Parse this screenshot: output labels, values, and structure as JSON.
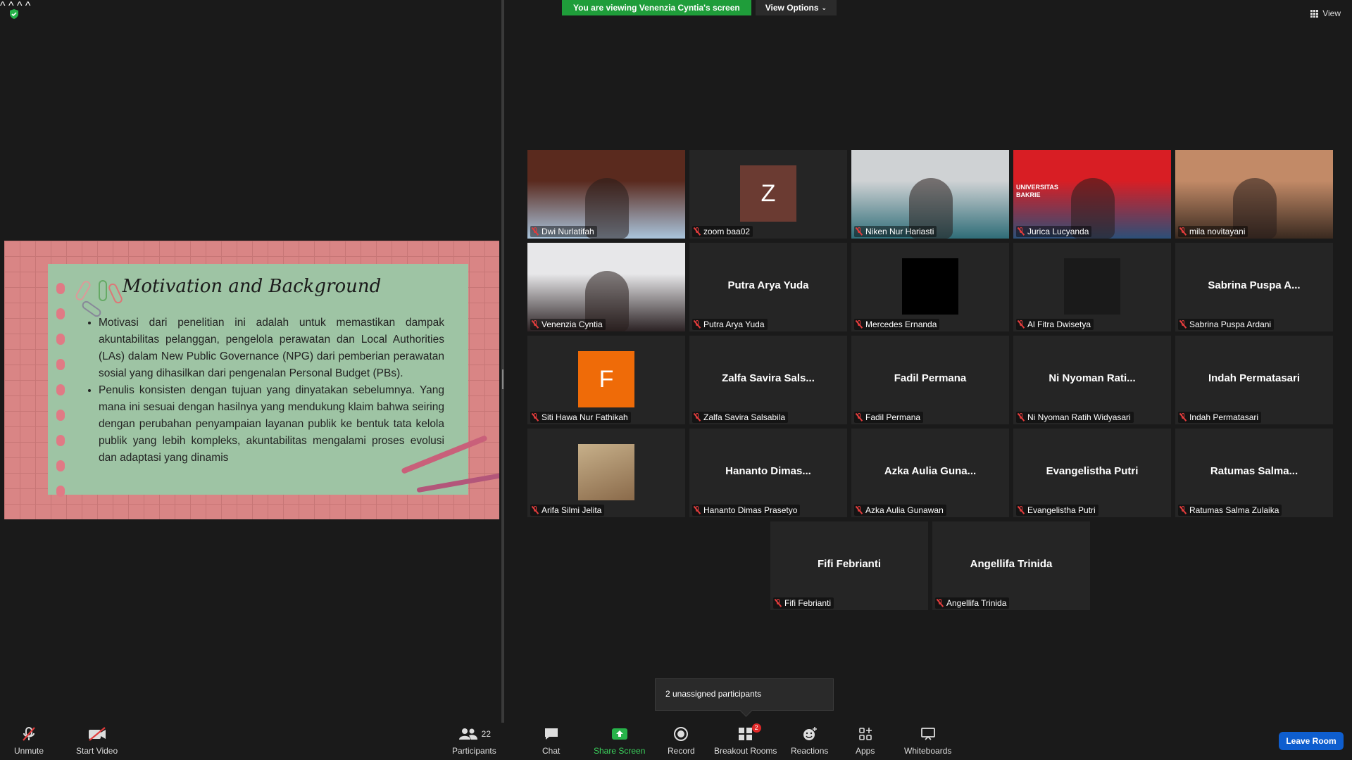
{
  "banner": {
    "viewing": "You are viewing Venenzia Cyntia's screen",
    "view_options": "View Options"
  },
  "view_label": "View",
  "slide": {
    "title": "Motivation and Background",
    "bullets": [
      "Motivasi dari penelitian ini adalah untuk memastikan dampak akuntabilitas pelanggan, pengelola perawatan dan Local Authorities (LAs) dalam New Public Governance (NPG) dari pemberian perawatan sosial yang dihasilkan dari pengenalan Personal Budget (PBs).",
      "Penulis konsisten dengan tujuan yang dinyatakan sebelumnya. Yang mana ini sesuai dengan hasilnya yang mendukung klaim bahwa seiring dengan perubahan penyampaian layanan publik ke bentuk tata kelola publik yang lebih kompleks, akuntabilitas mengalami proses evolusi dan adaptasi yang dinamis"
    ]
  },
  "participants": [
    {
      "label": "Dwi Nurlatifah",
      "center": "",
      "avatar": "",
      "type": "video",
      "colors": [
        "#5a2a1e",
        "#a9c4dc"
      ]
    },
    {
      "label": "zoom baa02",
      "center": "",
      "avatar": "Z",
      "type": "avatar",
      "colors": [
        "#6b3b32"
      ]
    },
    {
      "label": "Niken Nur Hariasti",
      "center": "",
      "avatar": "",
      "type": "video",
      "colors": [
        "#cfd2d4",
        "#2f6d78"
      ]
    },
    {
      "label": "Jurica Lucyanda",
      "center": "",
      "avatar": "",
      "type": "video",
      "colors": [
        "#d81e24",
        "#2c4f78"
      ],
      "overlay": "UNIVERSITAS BAKRIE"
    },
    {
      "label": "mila novitayani",
      "center": "",
      "avatar": "",
      "type": "video",
      "colors": [
        "#c28a67",
        "#3a2a20"
      ],
      "active": true
    },
    {
      "label": "Venenzia Cyntia",
      "center": "",
      "avatar": "",
      "type": "video",
      "colors": [
        "#e7e7e9",
        "#2b2224"
      ]
    },
    {
      "label": "Putra Arya Yuda",
      "center": "Putra Arya Yuda",
      "avatar": "",
      "type": "name"
    },
    {
      "label": "Mercedes Ernanda",
      "center": "",
      "avatar": "",
      "type": "black"
    },
    {
      "label": "Al Fitra Dwisetya",
      "center": "",
      "avatar": "",
      "type": "dark"
    },
    {
      "label": "Sabrina Puspa Ardani",
      "center": "Sabrina Puspa A...",
      "avatar": "",
      "type": "name"
    },
    {
      "label": "Siti Hawa Nur Fathikah",
      "center": "",
      "avatar": "F",
      "type": "avatar",
      "colors": [
        "#ef6b08"
      ]
    },
    {
      "label": "Zalfa Savira Salsabila",
      "center": "Zalfa Savira Sals...",
      "avatar": "",
      "type": "name"
    },
    {
      "label": "Fadil Permana",
      "center": "Fadil Permana",
      "avatar": "",
      "type": "name"
    },
    {
      "label": "Ni Nyoman Ratih Widyasari",
      "center": "Ni Nyoman Rati...",
      "avatar": "",
      "type": "name"
    },
    {
      "label": "Indah Permatasari",
      "center": "Indah Permatasari",
      "avatar": "",
      "type": "name"
    },
    {
      "label": "Arifa Silmi Jelita",
      "center": "",
      "avatar": "",
      "type": "photo",
      "colors": [
        "#c7b08a",
        "#8a6a4a"
      ]
    },
    {
      "label": "Hananto Dimas Prasetyo",
      "center": "Hananto Dimas...",
      "avatar": "",
      "type": "name"
    },
    {
      "label": "Azka Aulia Gunawan",
      "center": "Azka Aulia Guna...",
      "avatar": "",
      "type": "name"
    },
    {
      "label": "Evangelistha Putri",
      "center": "Evangelistha Putri",
      "avatar": "",
      "type": "name"
    },
    {
      "label": "Ratumas Salma Zulaika",
      "center": "Ratumas Salma...",
      "avatar": "",
      "type": "name"
    },
    {
      "label": "Fifi Febrianti",
      "center": "Fifi Febrianti",
      "avatar": "",
      "type": "name"
    },
    {
      "label": "Angellifa Trinida",
      "center": "Angellifa Trinida",
      "avatar": "",
      "type": "name"
    }
  ],
  "popup": {
    "unassigned": "2 unassigned participants"
  },
  "toolbar": {
    "unmute": "Unmute",
    "start_video": "Start Video",
    "participants": "Participants",
    "participants_count": "22",
    "chat": "Chat",
    "share_screen": "Share Screen",
    "record": "Record",
    "breakout_rooms": "Breakout Rooms",
    "breakout_badge": "2",
    "reactions": "Reactions",
    "apps": "Apps",
    "whiteboards": "Whiteboards",
    "leave": "Leave Room"
  },
  "colors": {
    "accent_green": "#1f9d3a",
    "leave_blue": "#0e5ecf",
    "active_speaker": "#e6e05a",
    "muted_red": "#e23c3c"
  }
}
